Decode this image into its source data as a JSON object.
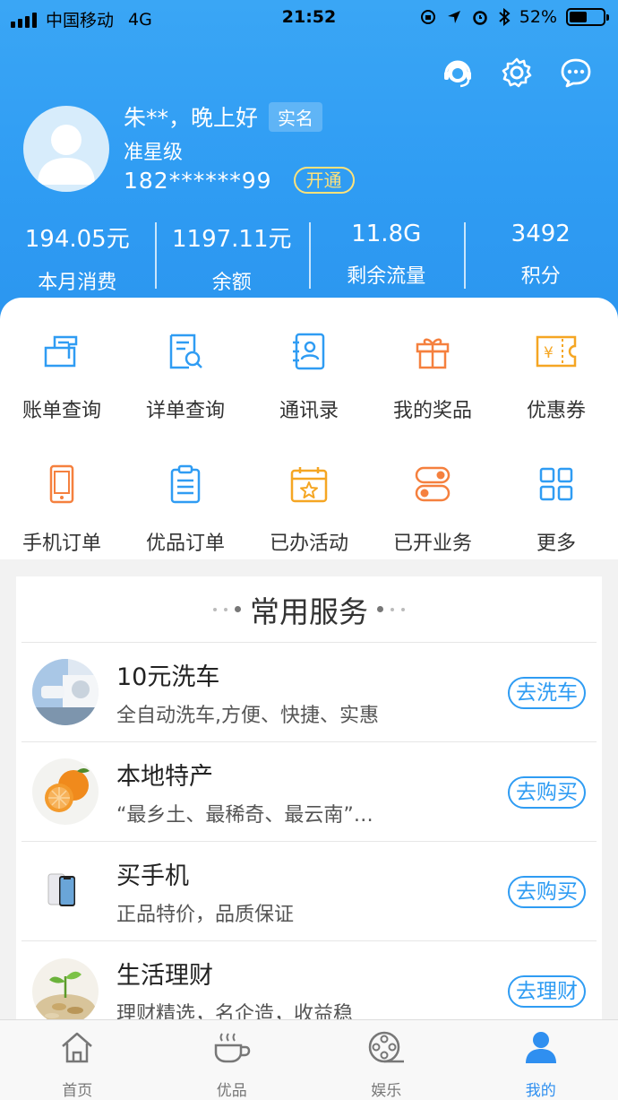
{
  "status": {
    "carrier": "中国移动",
    "network": "4G",
    "time": "21:52",
    "battery": "52%",
    "battery_level": 0.52
  },
  "user": {
    "greeting": "朱**，晚上好",
    "real_name_badge": "实名",
    "level": "准星级",
    "phone": "182******99",
    "open_button": "开通"
  },
  "stats": [
    {
      "value": "194.05元",
      "label": "本月消费"
    },
    {
      "value": "1197.11元",
      "label": "余额"
    },
    {
      "value": "11.8G",
      "label": "剩余流量"
    },
    {
      "value": "3492",
      "label": "积分"
    }
  ],
  "grid": [
    {
      "label": "账单查询",
      "icon": "bill-icon"
    },
    {
      "label": "详单查询",
      "icon": "detail-search-icon"
    },
    {
      "label": "通讯录",
      "icon": "contacts-icon"
    },
    {
      "label": "我的奖品",
      "icon": "gift-icon"
    },
    {
      "label": "优惠券",
      "icon": "coupon-icon"
    },
    {
      "label": "手机订单",
      "icon": "phone-order-icon"
    },
    {
      "label": "优品订单",
      "icon": "clipboard-icon"
    },
    {
      "label": "已办活动",
      "icon": "calendar-star-icon"
    },
    {
      "label": "已开业务",
      "icon": "toggle-icon"
    },
    {
      "label": "更多",
      "icon": "grid-more-icon"
    }
  ],
  "services": {
    "title": "常用服务",
    "items": [
      {
        "title": "10元洗车",
        "desc": "全自动洗车,方便、快捷、实惠",
        "button": "去洗车"
      },
      {
        "title": "本地特产",
        "desc": "“最乡土、最稀奇、最云南”…",
        "button": "去购买"
      },
      {
        "title": "买手机",
        "desc": "正品特价，品质保证",
        "button": "去购买"
      },
      {
        "title": "生活理财",
        "desc": "理财精选，名企造，收益稳",
        "button": "去理财"
      }
    ]
  },
  "tabs": [
    {
      "label": "首页",
      "icon": "home-icon"
    },
    {
      "label": "优品",
      "icon": "coffee-cup-icon"
    },
    {
      "label": "娱乐",
      "icon": "film-reel-icon"
    },
    {
      "label": "我的",
      "icon": "user-icon"
    }
  ],
  "colors": {
    "primary": "#2f9cf3",
    "orange": "#f5803e",
    "yellow": "#f5a623",
    "accent": "#ffe27a"
  }
}
